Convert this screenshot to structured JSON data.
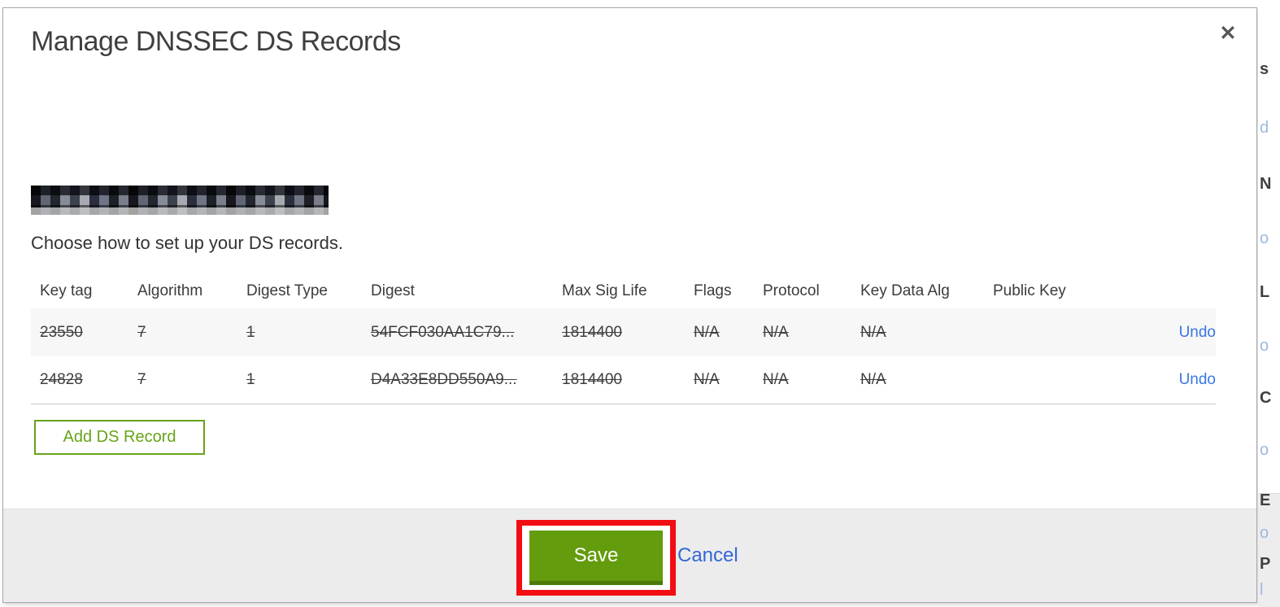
{
  "modal": {
    "title": "Manage DNSSEC DS Records",
    "close_label": "✕",
    "domain_redacted": true,
    "instruction": "Choose how to set up your DS records.",
    "table": {
      "columns": [
        "Key tag",
        "Algorithm",
        "Digest Type",
        "Digest",
        "Max Sig Life",
        "Flags",
        "Protocol",
        "Key Data Alg",
        "Public Key"
      ],
      "rows": [
        {
          "key_tag": "23550",
          "algorithm": "7",
          "digest_type": "1",
          "digest": "54FCF030AA1C79...",
          "max_sig_life": "1814400",
          "flags": "N/A",
          "protocol": "N/A",
          "key_data_alg": "N/A",
          "public_key": "",
          "action": "Undo",
          "deleted": true
        },
        {
          "key_tag": "24828",
          "algorithm": "7",
          "digest_type": "1",
          "digest": "D4A33E8DD550A9...",
          "max_sig_life": "1814400",
          "flags": "N/A",
          "protocol": "N/A",
          "key_data_alg": "N/A",
          "public_key": "",
          "action": "Undo",
          "deleted": true
        }
      ]
    },
    "add_button_label": "Add DS Record",
    "footer": {
      "save_label": "Save",
      "cancel_label": "Cancel"
    }
  },
  "background_strip": {
    "chars": [
      "s",
      "d",
      "N",
      "o",
      "L",
      "o",
      "C",
      "o",
      "E",
      "o",
      "P",
      "l"
    ]
  },
  "colors": {
    "accent_green": "#68a318",
    "save_green": "#639c0c",
    "save_green_dark": "#4c7a0a",
    "link_blue": "#3a76e4",
    "cancel_blue": "#3567d6",
    "annotation_red": "#f20d12",
    "footer_gray": "#ececec",
    "row_stripe": "#f7f7f7",
    "title_gray": "#3f3f3f"
  }
}
